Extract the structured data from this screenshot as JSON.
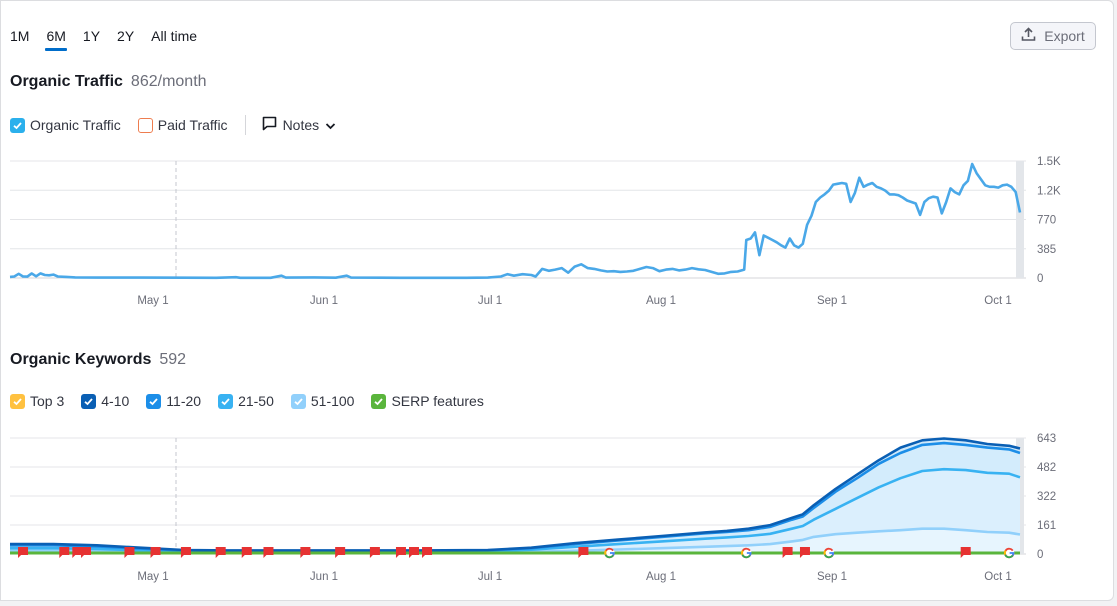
{
  "periods": [
    {
      "label": "1M",
      "active": false
    },
    {
      "label": "6M",
      "active": true
    },
    {
      "label": "1Y",
      "active": false
    },
    {
      "label": "2Y",
      "active": false
    },
    {
      "label": "All time",
      "active": false
    }
  ],
  "export": {
    "label": "Export",
    "icon": "upload-icon"
  },
  "traffic": {
    "title": "Organic Traffic",
    "value": "862/month",
    "legend": [
      {
        "label": "Organic Traffic",
        "checked": true,
        "color": "#2bb0ec"
      },
      {
        "label": "Paid Traffic",
        "checked": false,
        "color": "#ee7d4f"
      }
    ],
    "notes_label": "Notes"
  },
  "keywords": {
    "title": "Organic Keywords",
    "value": "592",
    "legend": [
      {
        "label": "Top 3",
        "checked": true,
        "color": "#ffc140"
      },
      {
        "label": "4-10",
        "checked": true,
        "color": "#0a5fb4"
      },
      {
        "label": "11-20",
        "checked": true,
        "color": "#1c8ee8"
      },
      {
        "label": "21-50",
        "checked": true,
        "color": "#38b2f2"
      },
      {
        "label": "51-100",
        "checked": true,
        "color": "#91d0fb"
      },
      {
        "label": "SERP features",
        "checked": true,
        "color": "#5ab53c"
      }
    ]
  },
  "chart_data": [
    {
      "type": "line",
      "title": "Organic Traffic",
      "x_ticks": [
        "May 1",
        "Jun 1",
        "Jul 1",
        "Aug 1",
        "Sep 1",
        "Oct 1"
      ],
      "y_ticks": [
        "0",
        "385",
        "770",
        "1.2K",
        "1.5K"
      ],
      "ylim": [
        0,
        1540
      ],
      "grid": true,
      "x_unit": "days since Apr 6",
      "series": [
        {
          "name": "Organic Traffic",
          "color": "#4aa8e8",
          "points": [
            [
              0,
              15
            ],
            [
              2,
              20
            ],
            [
              4,
              55
            ],
            [
              6,
              20
            ],
            [
              8,
              18
            ],
            [
              10,
              60
            ],
            [
              12,
              22
            ],
            [
              14,
              60
            ],
            [
              16,
              40
            ],
            [
              18,
              35
            ],
            [
              20,
              45
            ],
            [
              22,
              20
            ],
            [
              26,
              15
            ],
            [
              30,
              8
            ],
            [
              40,
              5
            ],
            [
              60,
              5
            ],
            [
              80,
              4
            ],
            [
              95,
              3
            ],
            [
              104,
              10
            ],
            [
              106,
              3
            ],
            [
              120,
              2
            ],
            [
              125,
              30
            ],
            [
              127,
              5
            ],
            [
              140,
              8
            ],
            [
              150,
              4
            ],
            [
              155,
              30
            ],
            [
              157,
              5
            ],
            [
              180,
              3
            ],
            [
              210,
              3
            ],
            [
              220,
              5
            ],
            [
              226,
              20
            ],
            [
              229,
              50
            ],
            [
              232,
              30
            ],
            [
              236,
              50
            ],
            [
              240,
              40
            ],
            [
              242,
              20
            ],
            [
              245,
              120
            ],
            [
              248,
              95
            ],
            [
              251,
              110
            ],
            [
              254,
              130
            ],
            [
              257,
              70
            ],
            [
              260,
              150
            ],
            [
              263,
              180
            ],
            [
              266,
              130
            ],
            [
              269,
              120
            ],
            [
              272,
              100
            ],
            [
              275,
              85
            ],
            [
              278,
              90
            ],
            [
              281,
              80
            ],
            [
              284,
              85
            ],
            [
              287,
              95
            ],
            [
              290,
              120
            ],
            [
              293,
              145
            ],
            [
              296,
              130
            ],
            [
              299,
              90
            ],
            [
              302,
              110
            ],
            [
              305,
              120
            ],
            [
              308,
              100
            ],
            [
              311,
              110
            ],
            [
              314,
              130
            ],
            [
              317,
              115
            ],
            [
              320,
              105
            ],
            [
              323,
              80
            ],
            [
              326,
              55
            ],
            [
              329,
              60
            ],
            [
              332,
              80
            ],
            [
              335,
              85
            ],
            [
              338,
              110
            ],
            [
              339,
              500
            ],
            [
              341,
              520
            ],
            [
              343,
              600
            ],
            [
              345,
              300
            ],
            [
              347,
              560
            ],
            [
              349,
              530
            ],
            [
              351,
              500
            ],
            [
              353,
              470
            ],
            [
              355,
              430
            ],
            [
              357,
              400
            ],
            [
              359,
              520
            ],
            [
              361,
              430
            ],
            [
              363,
              400
            ],
            [
              365,
              450
            ],
            [
              367,
              700
            ],
            [
              369,
              820
            ],
            [
              371,
              1000
            ],
            [
              373,
              1060
            ],
            [
              375,
              1100
            ],
            [
              377,
              1150
            ],
            [
              379,
              1230
            ],
            [
              381,
              1240
            ],
            [
              383,
              1250
            ],
            [
              385,
              1240
            ],
            [
              387,
              1000
            ],
            [
              389,
              1120
            ],
            [
              391,
              1320
            ],
            [
              393,
              1200
            ],
            [
              395,
              1230
            ],
            [
              397,
              1250
            ],
            [
              399,
              1200
            ],
            [
              401,
              1180
            ],
            [
              403,
              1150
            ],
            [
              405,
              1100
            ],
            [
              407,
              1100
            ],
            [
              409,
              1090
            ],
            [
              411,
              1060
            ],
            [
              413,
              1020
            ],
            [
              415,
              1000
            ],
            [
              417,
              980
            ],
            [
              419,
              830
            ],
            [
              421,
              1000
            ],
            [
              423,
              1050
            ],
            [
              425,
              1070
            ],
            [
              427,
              1060
            ],
            [
              429,
              850
            ],
            [
              431,
              1000
            ],
            [
              433,
              1180
            ],
            [
              435,
              1130
            ],
            [
              437,
              1100
            ],
            [
              439,
              1220
            ],
            [
              441,
              1280
            ],
            [
              443,
              1500
            ],
            [
              445,
              1380
            ],
            [
              447,
              1300
            ],
            [
              449,
              1220
            ],
            [
              451,
              1200
            ],
            [
              453,
              1200
            ],
            [
              455,
              1190
            ],
            [
              457,
              1220
            ],
            [
              459,
              1230
            ],
            [
              461,
              1200
            ],
            [
              463,
              1130
            ],
            [
              465,
              862
            ]
          ]
        }
      ]
    },
    {
      "type": "area",
      "title": "Organic Keywords",
      "x_ticks": [
        "May 1",
        "Jun 1",
        "Jul 1",
        "Aug 1",
        "Sep 1",
        "Oct 1"
      ],
      "y_ticks": [
        "0",
        "161",
        "322",
        "482",
        "643"
      ],
      "ylim": [
        0,
        643
      ],
      "grid": true,
      "x": [
        0,
        20,
        40,
        60,
        80,
        100,
        130,
        160,
        190,
        220,
        240,
        260,
        280,
        300,
        320,
        330,
        340,
        350,
        360,
        365,
        370,
        380,
        390,
        400,
        410,
        420,
        430,
        440,
        450,
        460,
        465
      ],
      "series": [
        {
          "name": "4-10",
          "color": "#0a5fb4",
          "values": [
            55,
            55,
            48,
            35,
            22,
            20,
            20,
            20,
            20,
            22,
            35,
            60,
            80,
            100,
            120,
            128,
            140,
            160,
            200,
            220,
            270,
            360,
            440,
            520,
            590,
            630,
            640,
            630,
            610,
            600,
            585
          ]
        },
        {
          "name": "11-20",
          "color": "#1c8ee8",
          "values": [
            48,
            48,
            42,
            30,
            20,
            18,
            18,
            18,
            18,
            20,
            32,
            55,
            75,
            95,
            115,
            122,
            132,
            150,
            190,
            208,
            255,
            345,
            420,
            500,
            560,
            605,
            615,
            605,
            590,
            580,
            560
          ]
        },
        {
          "name": "21-50",
          "color": "#38b2f2",
          "values": [
            32,
            32,
            28,
            20,
            15,
            14,
            14,
            14,
            14,
            16,
            24,
            40,
            55,
            70,
            85,
            92,
            100,
            112,
            140,
            155,
            190,
            250,
            310,
            370,
            420,
            460,
            470,
            465,
            450,
            445,
            425
          ]
        },
        {
          "name": "51-100",
          "color": "#91d0fb",
          "values": [
            18,
            18,
            15,
            10,
            8,
            8,
            8,
            8,
            8,
            9,
            12,
            18,
            25,
            32,
            40,
            44,
            48,
            55,
            70,
            78,
            95,
            110,
            118,
            126,
            132,
            140,
            140,
            132,
            122,
            118,
            108
          ]
        }
      ],
      "annotations": {
        "note_flags_days": [
          6,
          25,
          31,
          35,
          55,
          67,
          81,
          97,
          109,
          119,
          136,
          152,
          168,
          180,
          186,
          192,
          264,
          358,
          366,
          440
        ],
        "google_update_days": [
          276,
          339,
          377,
          460
        ]
      }
    }
  ]
}
